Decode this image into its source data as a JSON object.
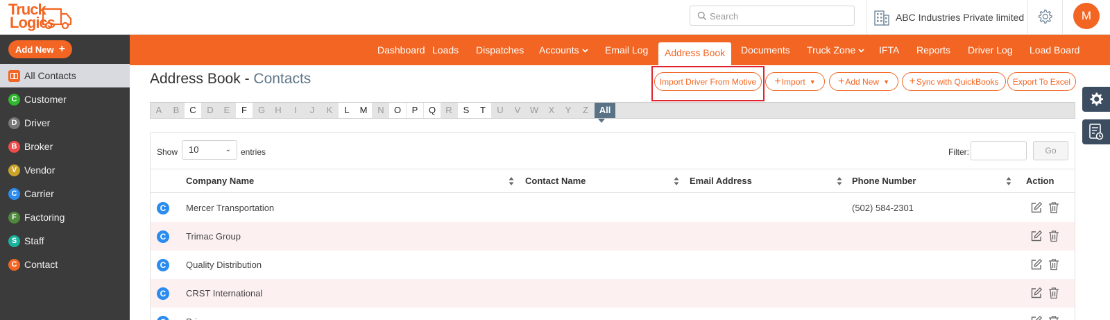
{
  "header": {
    "logo_line1": "Truck",
    "logo_line2": "Logics",
    "search_placeholder": "Search",
    "company_name": "ABC Industries Private limited",
    "avatar_initial": "M"
  },
  "sidebar": {
    "add_new_label": "Add New",
    "items": [
      {
        "label": "All Contacts",
        "letter": "",
        "color": "#f26522",
        "active": true
      },
      {
        "label": "Customer",
        "letter": "C",
        "color": "#2eb82e",
        "active": false
      },
      {
        "label": "Driver",
        "letter": "D",
        "color": "#777777",
        "active": false
      },
      {
        "label": "Broker",
        "letter": "B",
        "color": "#ef4b4b",
        "active": false
      },
      {
        "label": "Vendor",
        "letter": "V",
        "color": "#c9a227",
        "active": false
      },
      {
        "label": "Carrier",
        "letter": "C",
        "color": "#2b8cf0",
        "active": false
      },
      {
        "label": "Factoring",
        "letter": "F",
        "color": "#4e8a3c",
        "active": false
      },
      {
        "label": "Staff",
        "letter": "S",
        "color": "#1bb39c",
        "active": false
      },
      {
        "label": "Contact",
        "letter": "C",
        "color": "#f26522",
        "active": false
      }
    ]
  },
  "nav": {
    "items": [
      {
        "label": "Dashboard",
        "dropdown": false,
        "active": false
      },
      {
        "label": "Loads",
        "dropdown": false,
        "active": false
      },
      {
        "label": "Dispatches",
        "dropdown": false,
        "active": false
      },
      {
        "label": "Accounts",
        "dropdown": true,
        "active": false
      },
      {
        "label": "Email Log",
        "dropdown": false,
        "active": false
      },
      {
        "label": "Address Book",
        "dropdown": false,
        "active": true
      },
      {
        "label": "Documents",
        "dropdown": false,
        "active": false
      },
      {
        "label": "Truck Zone",
        "dropdown": true,
        "active": false
      },
      {
        "label": "IFTA",
        "dropdown": false,
        "active": false
      },
      {
        "label": "Reports",
        "dropdown": false,
        "active": false
      },
      {
        "label": "Driver Log",
        "dropdown": false,
        "active": false
      },
      {
        "label": "Load Board",
        "dropdown": false,
        "active": false
      }
    ]
  },
  "page": {
    "title": "Address Book - ",
    "subtitle": "Contacts",
    "actions": {
      "import_motive": "Import Driver From Motive",
      "import": "Import",
      "add_new": "Add New",
      "sync_qb": "Sync with QuickBooks",
      "export_excel": "Export To Excel"
    }
  },
  "alphabet": {
    "letters": [
      "A",
      "B",
      "C",
      "D",
      "E",
      "F",
      "G",
      "H",
      "I",
      "J",
      "K",
      "L",
      "M",
      "N",
      "O",
      "P",
      "Q",
      "R",
      "S",
      "T",
      "U",
      "V",
      "W",
      "X",
      "Y",
      "Z"
    ],
    "enabled": [
      "C",
      "F",
      "L",
      "M",
      "O",
      "P",
      "Q",
      "S",
      "T"
    ],
    "all_label": "All"
  },
  "table": {
    "show_label": "Show",
    "page_size": "10",
    "entries_label": "entries",
    "filter_label": "Filter:",
    "go_label": "Go",
    "columns": {
      "company": "Company Name",
      "contact": "Contact Name",
      "email": "Email Address",
      "phone": "Phone Number",
      "action": "Action"
    },
    "rows": [
      {
        "type": "C",
        "company": "Mercer Transportation",
        "contact": "",
        "email": "",
        "phone": "(502) 584-2301"
      },
      {
        "type": "C",
        "company": "Trimac Group",
        "contact": "",
        "email": "",
        "phone": ""
      },
      {
        "type": "C",
        "company": "Quality Distribution",
        "contact": "",
        "email": "",
        "phone": ""
      },
      {
        "type": "C",
        "company": "CRST International",
        "contact": "",
        "email": "",
        "phone": ""
      },
      {
        "type": "C",
        "company": "Pri...",
        "contact": "",
        "email": "",
        "phone": ""
      }
    ]
  },
  "colors": {
    "brand_orange": "#f26522",
    "sidebar_bg": "#3b3b3b",
    "highlight_red": "#e0232e",
    "alpha_all_bg": "#5a7285",
    "row_alt_bg": "#fdf0f1"
  }
}
